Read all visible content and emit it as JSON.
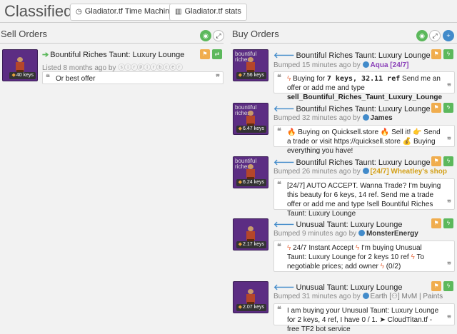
{
  "header": {
    "title": "Classifieds",
    "btn_time_machine": "Gladiator.tf Time Machine",
    "btn_stats": "Gladiator.tf stats"
  },
  "sell": {
    "title": "Sell Orders",
    "items": [
      {
        "thumb_sub": "",
        "price": "40 keys",
        "name": "Bountiful Riches Taunt: Luxury Lounge",
        "meta_prefix": "Listed 8 months ago by",
        "user": "ⓢⓘⓡⓟⓘⓡⓑⓒⓔⓡ",
        "note": "Or best offer"
      }
    ]
  },
  "buy": {
    "title": "Buy Orders",
    "items": [
      {
        "thumb_sub": "bountiful riches",
        "price": "7.56 keys",
        "name": "Bountiful Riches Taunt: Luxury Lounge",
        "meta_prefix": "Bumped 15 minutes ago by",
        "user": "Aqua [24/7]",
        "note_a": "Buying for ",
        "note_b": "7 keys, 32.11 ref",
        "note_c": " Send me an offer or add me and type ",
        "note_d": "sell_Bountiful_Riches_Taunt_Luxury_Lounge"
      },
      {
        "thumb_sub": "bountiful riches",
        "price": "6.47 keys",
        "name": "Bountiful Riches Taunt: Luxury Lounge",
        "meta_prefix": "Bumped 32 minutes ago by",
        "user": "James",
        "note": "🔥 Buying on Quicksell.store 🔥 Sell it! 👉 Send a trade or visit https://quicksell.store 💰 Buying everything you have!"
      },
      {
        "thumb_sub": "bountiful riches",
        "price": "6.24 keys",
        "name": "Bountiful Riches Taunt: Luxury Lounge",
        "meta_prefix": "Bumped 26 minutes ago by",
        "user": "[24/7] Wheatley's shop",
        "note": "[24/7] AUTO ACCEPT. Wanna Trade? I'm buying this beauty for 6 keys, 14 ref. Send me a trade offer or add me and type !sell Bountiful Riches Taunt: Luxury Lounge"
      },
      {
        "thumb_sub": "",
        "price": "2.17 keys",
        "name": "Unusual Taunt: Luxury Lounge",
        "meta_prefix": "Bumped 9 minutes ago by",
        "user": "MonsterEnergy",
        "note_a": " 24/7 Instant Accept ",
        "note_b": " I'm buying Unusual Taunt: Luxury Lounge for 2 keys 10 ref ",
        "note_c": " To negotiable prices; add owner ",
        "note_d": " (0/2)"
      },
      {
        "thumb_sub": "",
        "price": "2.07 keys",
        "name": "Unusual Taunt: Luxury Lounge",
        "meta_prefix": "Bumped 31 minutes ago by",
        "user": "Earth [",
        "user_tail": "] MvM | Paints",
        "note": "I am buying your Unusual Taunt: Luxury Lounge for 2 keys, 4 ref, I have 0 / 1. ➤ CloudTitan.tf - free TF2 bot service"
      }
    ]
  }
}
